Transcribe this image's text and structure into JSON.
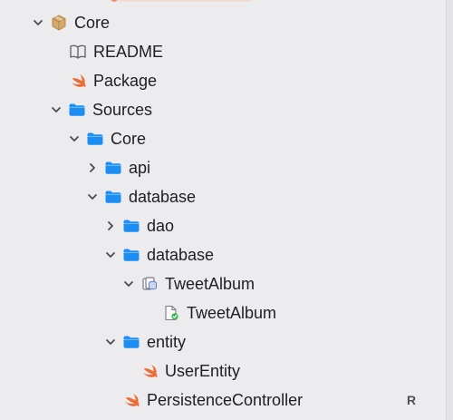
{
  "tree": {
    "core_root": {
      "label": "Core"
    },
    "readme": {
      "label": "README"
    },
    "package": {
      "label": "Package"
    },
    "sources": {
      "label": "Sources"
    },
    "core_folder": {
      "label": "Core"
    },
    "api": {
      "label": "api"
    },
    "database_group": {
      "label": "database"
    },
    "dao": {
      "label": "dao"
    },
    "database_subgroup": {
      "label": "database"
    },
    "tweet_album_model": {
      "label": "TweetAlbum"
    },
    "tweet_album_version": {
      "label": "TweetAlbum"
    },
    "entity": {
      "label": "entity"
    },
    "user_entity": {
      "label": "UserEntity"
    },
    "persistence_controller": {
      "label": "PersistenceController",
      "status": "R"
    }
  },
  "colors": {
    "folder_blue": "#1b8df3",
    "swift_orange": "#f06a35",
    "package_gold": "#c9a065",
    "badge_gray": "#505055"
  },
  "icons": {
    "package": "package-icon",
    "readme": "book-icon",
    "swift": "swift-file-icon",
    "folder": "folder-icon",
    "data_model": "data-model-icon",
    "model_version": "model-version-icon"
  }
}
